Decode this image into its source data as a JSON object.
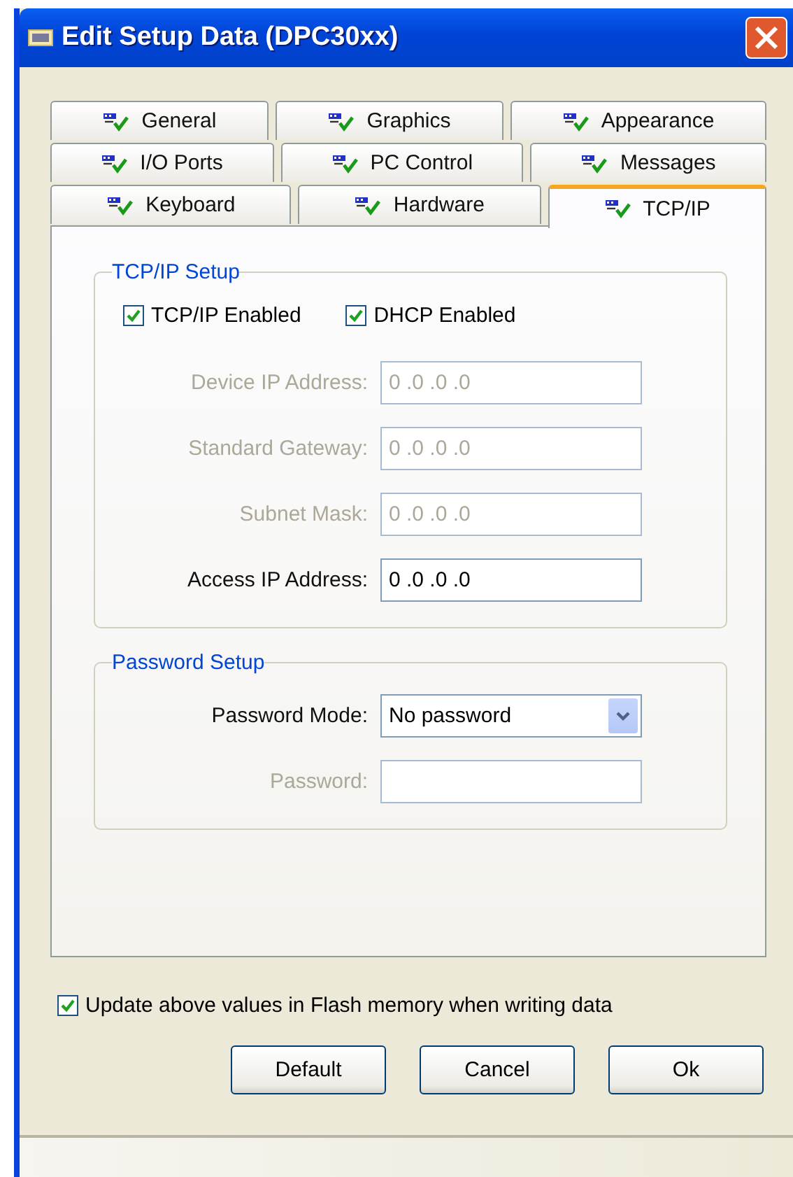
{
  "window": {
    "title": "Edit Setup Data (DPC30xx)"
  },
  "tab_rows": [
    [
      {
        "label": "General",
        "selected": false
      },
      {
        "label": "Graphics",
        "selected": false
      },
      {
        "label": "Appearance",
        "selected": false
      }
    ],
    [
      {
        "label": "I/O Ports",
        "selected": false
      },
      {
        "label": "PC Control",
        "selected": false
      },
      {
        "label": "Messages",
        "selected": false
      }
    ],
    [
      {
        "label": "Keyboard",
        "selected": false
      },
      {
        "label": "Hardware",
        "selected": false
      },
      {
        "label": "TCP/IP",
        "selected": true
      }
    ]
  ],
  "groups": [
    {
      "title": "TCP/IP Setup",
      "checkboxes": [
        {
          "label": "TCP/IP Enabled",
          "checked": true
        },
        {
          "label": "DHCP Enabled",
          "checked": true
        }
      ],
      "fields": [
        {
          "kind": "text",
          "label": "Device IP Address:",
          "value": "0 .0 .0 .0",
          "disabled": true
        },
        {
          "kind": "text",
          "label": "Standard Gateway:",
          "value": "0 .0 .0 .0",
          "disabled": true
        },
        {
          "kind": "text",
          "label": "Subnet Mask:",
          "value": "0 .0 .0 .0",
          "disabled": true
        },
        {
          "kind": "text",
          "label": "Access IP Address:",
          "value": "0 .0 .0 .0",
          "disabled": false
        }
      ]
    },
    {
      "title": "Password Setup",
      "fields": [
        {
          "kind": "dropdown",
          "label": "Password Mode:",
          "value": "No password",
          "disabled": false
        },
        {
          "kind": "text",
          "label": "Password:",
          "disabled": true
        }
      ]
    }
  ],
  "flash_checkbox": {
    "label": "Update above values in Flash memory when writing data",
    "checked": true
  },
  "buttons": [
    "Default",
    "Cancel",
    "Ok"
  ]
}
